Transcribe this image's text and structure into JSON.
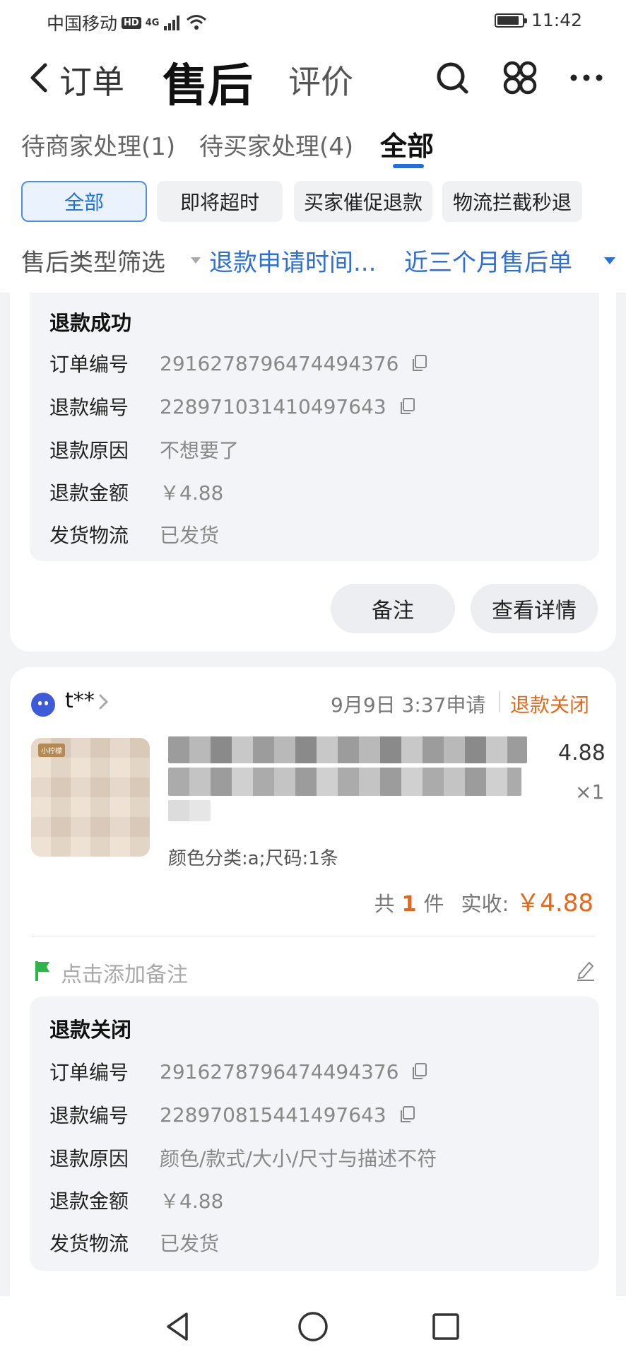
{
  "status_bar": {
    "carrier": "中国移动",
    "hd_badge": "HD",
    "network": "4G",
    "time": "11:42"
  },
  "header": {
    "order": "订单",
    "aftersale": "售后",
    "review": "评价",
    "icons": [
      "back-arrow",
      "search-icon",
      "apps-icon",
      "more-icon"
    ]
  },
  "tabs": [
    {
      "label": "待商家处理(1)",
      "active": false
    },
    {
      "label": "待买家处理(4)",
      "active": false
    },
    {
      "label": "全部",
      "active": true
    }
  ],
  "chips": [
    {
      "label": "全部",
      "active": true
    },
    {
      "label": "即将超时",
      "active": false
    },
    {
      "label": "买家催促退款",
      "active": false
    },
    {
      "label": "物流拦截秒退",
      "active": false
    }
  ],
  "filter": {
    "type_label": "售后类型筛选",
    "time_label": "退款申请时间...",
    "range_label": "近三个月售后单"
  },
  "card1": {
    "status": "退款成功",
    "rows": [
      {
        "label": "订单编号",
        "value": "2916278796474494376",
        "copyable": true
      },
      {
        "label": "退款编号",
        "value": "228971031410497643",
        "copyable": true
      },
      {
        "label": "退款原因",
        "value": "不想要了",
        "copyable": false
      },
      {
        "label": "退款金额",
        "value": "￥4.88",
        "copyable": false
      },
      {
        "label": "发货物流",
        "value": "已发货",
        "copyable": false
      }
    ],
    "buttons": {
      "note": "备注",
      "detail": "查看详情"
    }
  },
  "card2": {
    "buyer": "t**",
    "apply_time": "9月9日 3:37申请",
    "status": "退款关闭",
    "product": {
      "price_tail": "4.88",
      "quantity": "×1",
      "sku": "颜色分类:a;尺码:1条",
      "thumb_tag": "小柠檬"
    },
    "total": {
      "prefix": "共",
      "count": "1",
      "unit": "件",
      "received_label": "实收:",
      "amount": "￥4.88"
    },
    "note_placeholder": "点击添加备注",
    "info": {
      "status": "退款关闭",
      "rows": [
        {
          "label": "订单编号",
          "value": "2916278796474494376",
          "copyable": true
        },
        {
          "label": "退款编号",
          "value": "228970815441497643",
          "copyable": true
        },
        {
          "label": "退款原因",
          "value": "颜色/款式/大小/尺寸与描述不符",
          "copyable": false
        },
        {
          "label": "退款金额",
          "value": "￥4.88",
          "copyable": false
        },
        {
          "label": "发货物流",
          "value": "已发货",
          "copyable": false
        }
      ]
    }
  },
  "colors": {
    "accent_blue": "#1f6fe0",
    "link_blue": "#2d6fd6",
    "status_orange": "#e2691c",
    "flag_green": "#2fb34a"
  }
}
